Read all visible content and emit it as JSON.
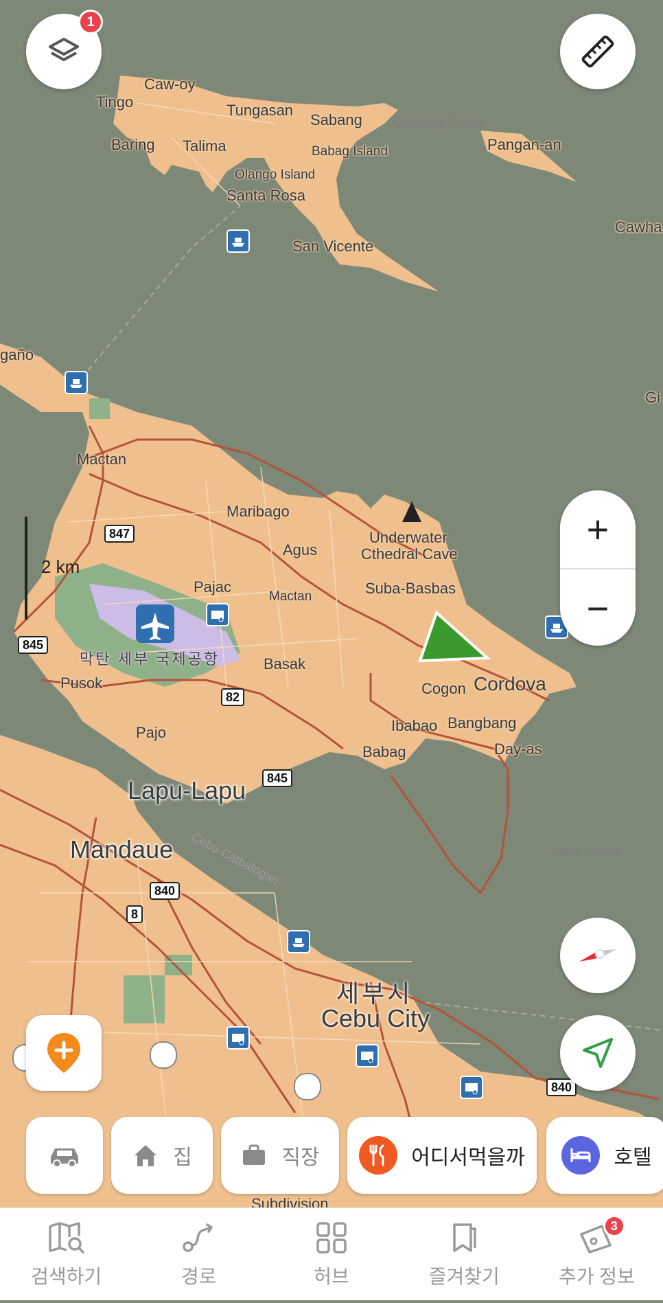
{
  "map": {
    "water_color": "#7d8877",
    "land_color": "#efc08e",
    "road_color": "#b5523a",
    "labels": {
      "caw_oy": "Caw-oy",
      "tingo": "Tingo",
      "tungasan": "Tungasan",
      "sabang": "Sabang",
      "camungi": "Camungi Island",
      "baring": "Baring",
      "talima": "Talima",
      "babag_island": "Babag Island",
      "pangan_an": "Pangan-an",
      "olango": "Olango Island",
      "santa_rosa": "Santa Rosa",
      "cawha": "Cawha",
      "san_vicente": "San Vicente",
      "gano": "gaño",
      "gi": "Gi",
      "mactan": "Mactan",
      "maribago": "Maribago",
      "underwater1": "Underwater",
      "underwater2": "Cthedral Cave",
      "agus": "Agus",
      "pajac": "Pajac",
      "mactan_small": "Mactan",
      "suba_basbas": "Suba-Basbas",
      "airport_ko": "막탄 세부 국제공항",
      "basak": "Basak",
      "pusok": "Pusok",
      "cogon": "Cogon",
      "cordova": "Cordova",
      "pajo": "Pajo",
      "ibabao": "Ibabao",
      "bangbang": "Bangbang",
      "day_as": "Day-as",
      "babag": "Babag",
      "lapu_lapu": "Lapu-Lapu",
      "mandaue": "Mandaue",
      "cebu_catbalogan": "Cebu-Catbalogan",
      "lava_island": "Lava Island",
      "cebu_ko": "세부시",
      "cebu_city": "Cebu City",
      "subdivision": "Subdivision"
    },
    "shields": {
      "r847": "847",
      "r845a": "845",
      "r82": "82",
      "r845b": "845",
      "r840a": "840",
      "r8": "8",
      "r840b": "840"
    },
    "scale_label": "2 km"
  },
  "controls": {
    "layers_badge": "1",
    "zoom_in": "+",
    "zoom_out": "−"
  },
  "chips": {
    "car_icon": "car-icon",
    "home_label": "집",
    "work_label": "직장",
    "food_label": "어디서먹을까",
    "hotel_label": "호텔"
  },
  "nav": {
    "search": "검색하기",
    "route": "경로",
    "hub": "허브",
    "favorites": "즐겨찾기",
    "more": "추가 정보",
    "more_badge": "3"
  }
}
